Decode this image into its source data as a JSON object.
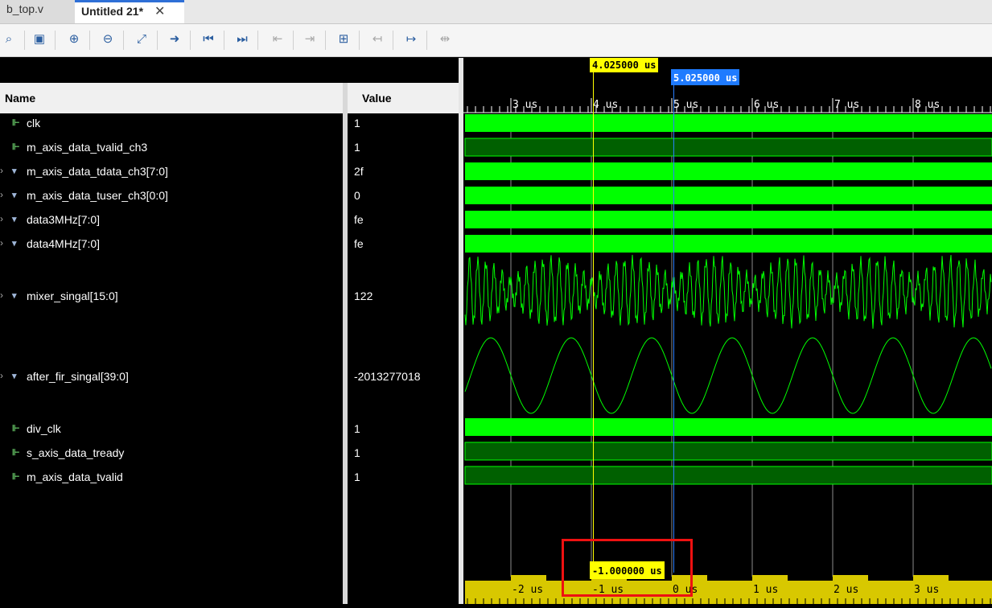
{
  "tabs": [
    {
      "label": "b_top.v",
      "active": false
    },
    {
      "label": "Untitled 21*",
      "active": true
    }
  ],
  "close_glyph": "✕",
  "toolbar": {
    "buttons": [
      {
        "icon": "search-icon",
        "glyph": "⌕"
      },
      {
        "icon": "save-icon",
        "glyph": "▣"
      },
      {
        "icon": "zoom-in-icon",
        "glyph": "⊕"
      },
      {
        "icon": "zoom-out-icon",
        "glyph": "⊖"
      },
      {
        "icon": "zoom-fit-icon",
        "glyph": "⤢"
      },
      {
        "icon": "go-to-cursor-icon",
        "glyph": "➜"
      },
      {
        "icon": "go-to-start-icon",
        "glyph": "⏮"
      },
      {
        "icon": "go-to-end-icon",
        "glyph": "⏭"
      },
      {
        "icon": "previous-transition-icon",
        "glyph": "⇤"
      },
      {
        "icon": "next-transition-icon",
        "glyph": "⇥"
      },
      {
        "icon": "add-marker-icon",
        "glyph": "⊞"
      },
      {
        "icon": "previous-marker-icon",
        "glyph": "↤"
      },
      {
        "icon": "next-marker-icon",
        "glyph": "↦"
      },
      {
        "icon": "swap-cursors-icon",
        "glyph": "⇹"
      }
    ]
  },
  "columns": {
    "name": "Name",
    "value": "Value"
  },
  "signals": [
    {
      "name": "clk",
      "value": "1",
      "expandable": false,
      "icon": "bit-icon",
      "glyph": "⊩"
    },
    {
      "name": "m_axis_data_tvalid_ch3",
      "value": "1",
      "expandable": false,
      "icon": "bit-icon",
      "glyph": "⊩"
    },
    {
      "name": "m_axis_data_tdata_ch3[7:0]",
      "value": "2f",
      "expandable": true,
      "icon": "bus-icon",
      "glyph": "▾"
    },
    {
      "name": "m_axis_data_tuser_ch3[0:0]",
      "value": "0",
      "expandable": true,
      "icon": "bus-icon",
      "glyph": "▾"
    },
    {
      "name": "data3MHz[7:0]",
      "value": "fe",
      "expandable": true,
      "icon": "bus-icon",
      "glyph": "▾"
    },
    {
      "name": "data4MHz[7:0]",
      "value": "fe",
      "expandable": true,
      "icon": "bus-icon",
      "glyph": "▾"
    },
    {
      "name": "mixer_singal[15:0]",
      "value": "122",
      "expandable": true,
      "icon": "bus-icon",
      "glyph": "▾"
    },
    {
      "name": "after_fir_singal[39:0]",
      "value": "-2013277018",
      "expandable": true,
      "icon": "bus-icon",
      "glyph": "▾"
    },
    {
      "name": "div_clk",
      "value": "1",
      "expandable": false,
      "icon": "bit-icon",
      "glyph": "⊩"
    },
    {
      "name": "s_axis_data_tready",
      "value": "1",
      "expandable": false,
      "icon": "bit-icon",
      "glyph": "⊩"
    },
    {
      "name": "m_axis_data_tvalid",
      "value": "1",
      "expandable": false,
      "icon": "bit-icon",
      "glyph": "⊩"
    }
  ],
  "timeline": {
    "top_ticks": [
      "3 us",
      "4 us",
      "5 us",
      "6 us",
      "7 us",
      "8 us"
    ],
    "bottom_ticks": [
      "-2 us",
      "-1 us",
      "0 us",
      "1 us",
      "2 us",
      "3 us"
    ],
    "main_cursor": "4.025000 us",
    "secondary_cursor": "5.025000 us",
    "delta": "-1.000000 us"
  },
  "colors": {
    "wave": "#00ff00",
    "dark_wave": "#006000",
    "cursor_yellow": "#ffff00",
    "cursor_blue": "#2a7fff",
    "highlight": "#e11111"
  }
}
